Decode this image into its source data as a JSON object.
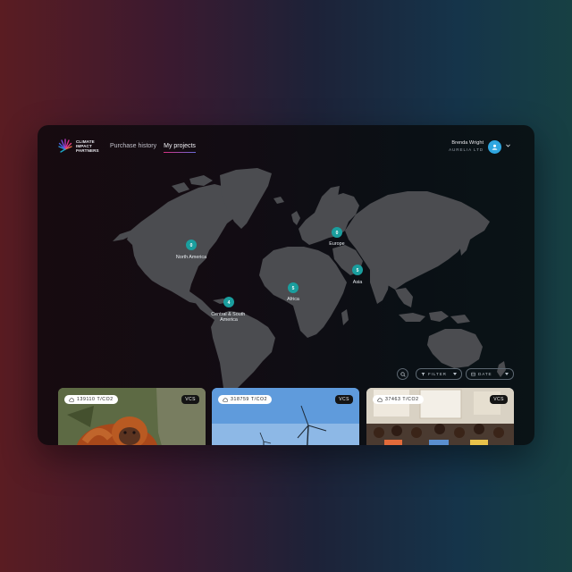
{
  "brand": {
    "name_lines": [
      "CLIMATE",
      "IMPACT",
      "PARTNERS"
    ],
    "logo_icon": "radial-fan-logo-icon"
  },
  "nav": {
    "items": [
      {
        "label": "Purchase history",
        "active": false
      },
      {
        "label": "My projects",
        "active": true
      }
    ]
  },
  "user": {
    "name": "Brenda Wright",
    "company": "AURELIA LTD",
    "avatar_icon": "user-icon",
    "menu_icon": "chevron-down-icon"
  },
  "map": {
    "regions": [
      {
        "name": "North America",
        "count": "0"
      },
      {
        "name": "Europe",
        "count": "0"
      },
      {
        "name": "Asia",
        "count": "5"
      },
      {
        "name": "Africa",
        "count": "5"
      },
      {
        "name": "Central & South\nAmerica",
        "count": "4"
      }
    ]
  },
  "filters": {
    "search_icon": "search-icon",
    "filter_label": "FILTER",
    "date_label": "DATE",
    "date_icon": "calendar-icon",
    "caret_icon": "caret-down-icon"
  },
  "projects": [
    {
      "tonnes": "139110 T/CO2",
      "standard": "VCS",
      "image": "orangutan-photo",
      "cloud_icon": "cloud-icon"
    },
    {
      "tonnes": "318759 T/CO2",
      "standard": "VCS",
      "image": "wind-turbines-photo",
      "cloud_icon": "cloud-icon"
    },
    {
      "tonnes": "37463 T/CO2",
      "standard": "VCS",
      "image": "classroom-children-photo",
      "cloud_icon": "cloud-icon"
    }
  ],
  "colors": {
    "accent_teal": "#1a9e9e",
    "avatar_blue": "#2fa6e0",
    "nav_underline_start": "#d62f7f",
    "nav_underline_end": "#6a6ad8",
    "land": "#4b4c50"
  }
}
